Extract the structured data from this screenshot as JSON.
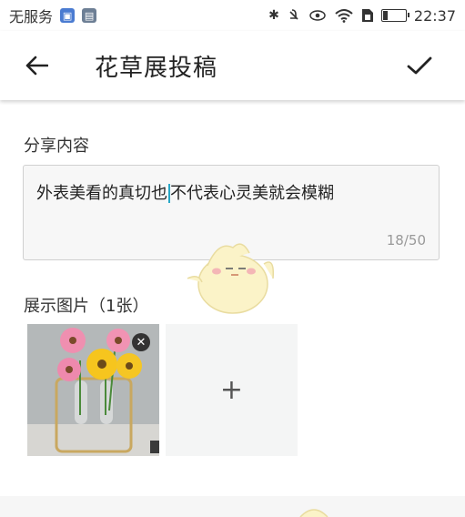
{
  "status_bar": {
    "carrier": "无服务",
    "time": "22:37",
    "battery_level": 0.2,
    "icons": [
      "app-notification-icon",
      "gallery-notification-icon",
      "bluetooth-icon",
      "mute-icon",
      "eye-comfort-icon",
      "wifi-icon",
      "sim-icon",
      "battery-icon"
    ]
  },
  "app_bar": {
    "title": "花草展投稿",
    "back_icon": "arrow-left-icon",
    "confirm_icon": "check-icon"
  },
  "share_section": {
    "label": "分享内容",
    "text": "外表美看的真切也不代表心灵美就会模糊",
    "char_count": "18/50"
  },
  "images_section": {
    "label": "展示图片（1张）",
    "images": [
      {
        "description_icon": "flower-vase-photo",
        "remove_icon": "close-icon"
      }
    ],
    "add_label": "+"
  },
  "colors": {
    "background": "#ffffff",
    "input_background": "#f7f7f7",
    "add_tile_background": "#f4f5f5",
    "cursor": "#29a8c7"
  }
}
